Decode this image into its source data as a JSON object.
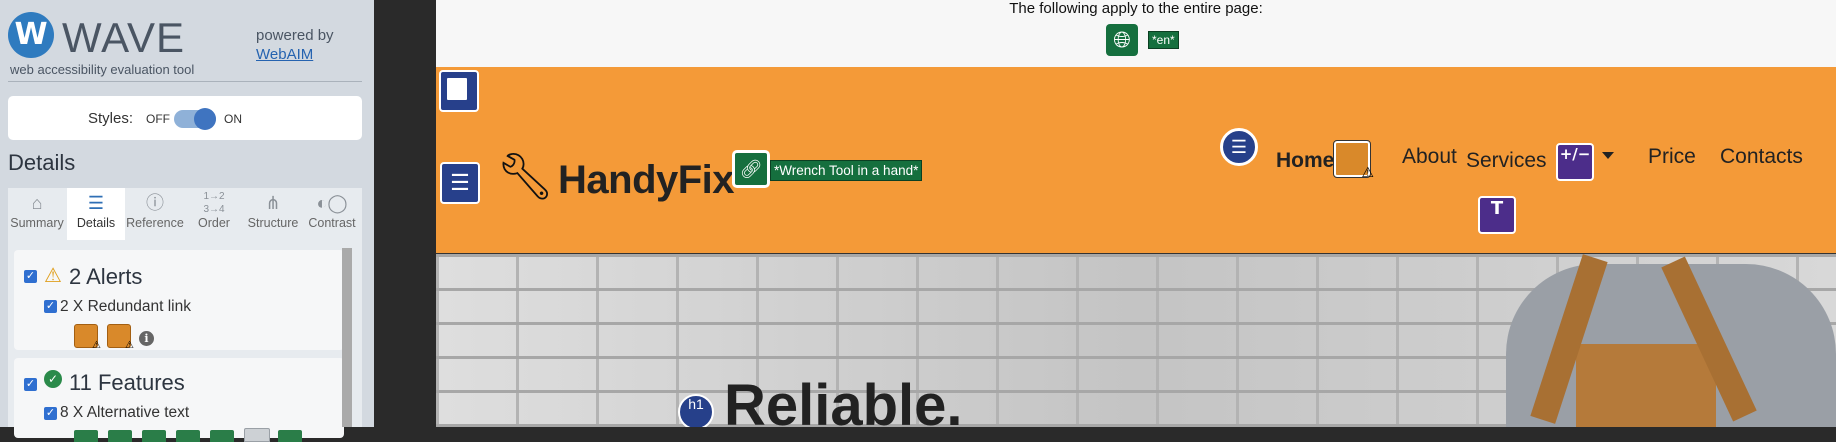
{
  "sidebar": {
    "logo_letter": "W",
    "app_title": "WAVE",
    "app_subtitle": "web accessibility evaluation tool",
    "powered_by": "powered by",
    "powered_link": "WebAIM",
    "styles": {
      "label": "Styles:",
      "off": "OFF",
      "on": "ON",
      "state": "on"
    },
    "details_title": "Details",
    "tabs": [
      {
        "label": "Summary",
        "icon": "home-icon"
      },
      {
        "label": "Details",
        "icon": "list-icon",
        "active": true
      },
      {
        "label": "Reference",
        "icon": "info-icon"
      },
      {
        "label": "Order",
        "icon": "order-icon"
      },
      {
        "label": "Structure",
        "icon": "structure-icon"
      },
      {
        "label": "Contrast",
        "icon": "contrast-icon"
      }
    ],
    "alerts": {
      "title": "2 Alerts",
      "item": "2 X Redundant link"
    },
    "features": {
      "title": "11 Features",
      "item": "8 X Alternative text"
    }
  },
  "page": {
    "banner_text": "The following apply to the entire page:",
    "lang_label": "*en*",
    "brand": "HandyFix",
    "alt_text": "*Wrench Tool in a hand*",
    "nav": {
      "home": "Home",
      "about": "About",
      "services": "Services",
      "price": "Price",
      "contacts": "Contacts"
    },
    "services_badge": "+/−",
    "h1_badge": "h1",
    "hero_title": "Reliable."
  },
  "colors": {
    "orange": "#f49a38",
    "wave_blue": "#27408b",
    "feature_green": "#156f3e",
    "aria_purple": "#4c2d8a",
    "alert_orange": "#d9892a"
  }
}
